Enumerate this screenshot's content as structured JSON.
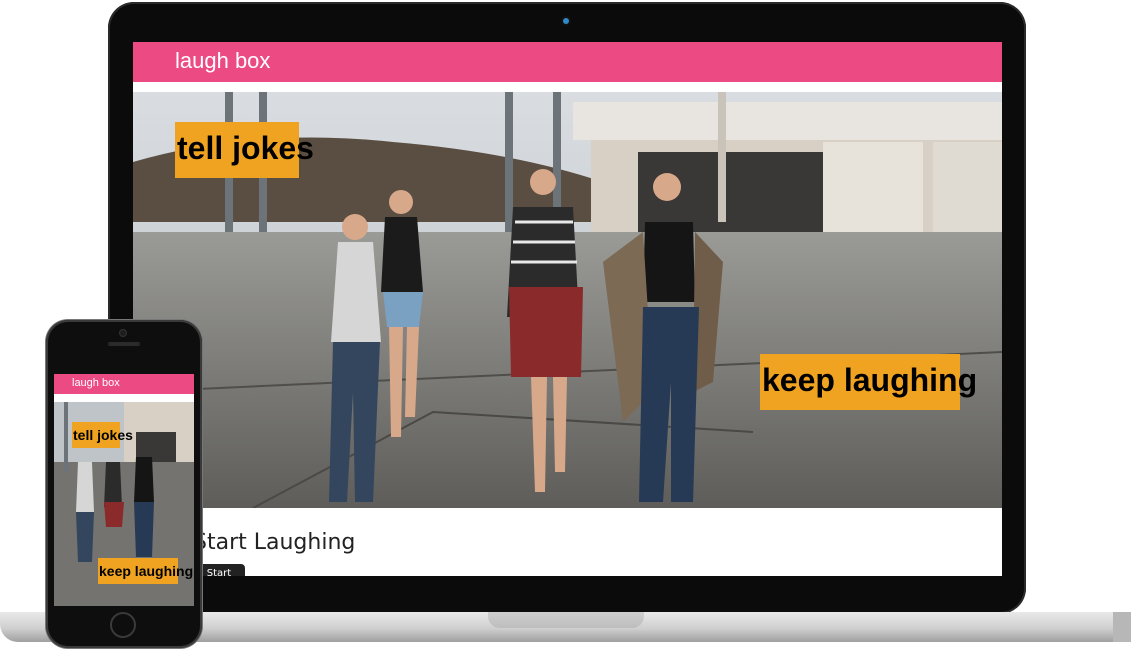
{
  "laptop": {
    "brand": "laugh box",
    "hero_tags": {
      "top": "tell jokes",
      "bottom": "keep laughing"
    },
    "cta": {
      "heading": "Start Laughing",
      "button": "Start"
    }
  },
  "phone": {
    "brand": "laugh box",
    "hero_tags": {
      "top": "tell jokes",
      "bottom": "keep laughing"
    }
  },
  "colors": {
    "nav": "#ec4a82",
    "tag": "#f0a320",
    "device": "#0b0b0b"
  },
  "icons": {
    "laptop_camera": "camera-icon",
    "phone_home": "home-button-icon"
  }
}
